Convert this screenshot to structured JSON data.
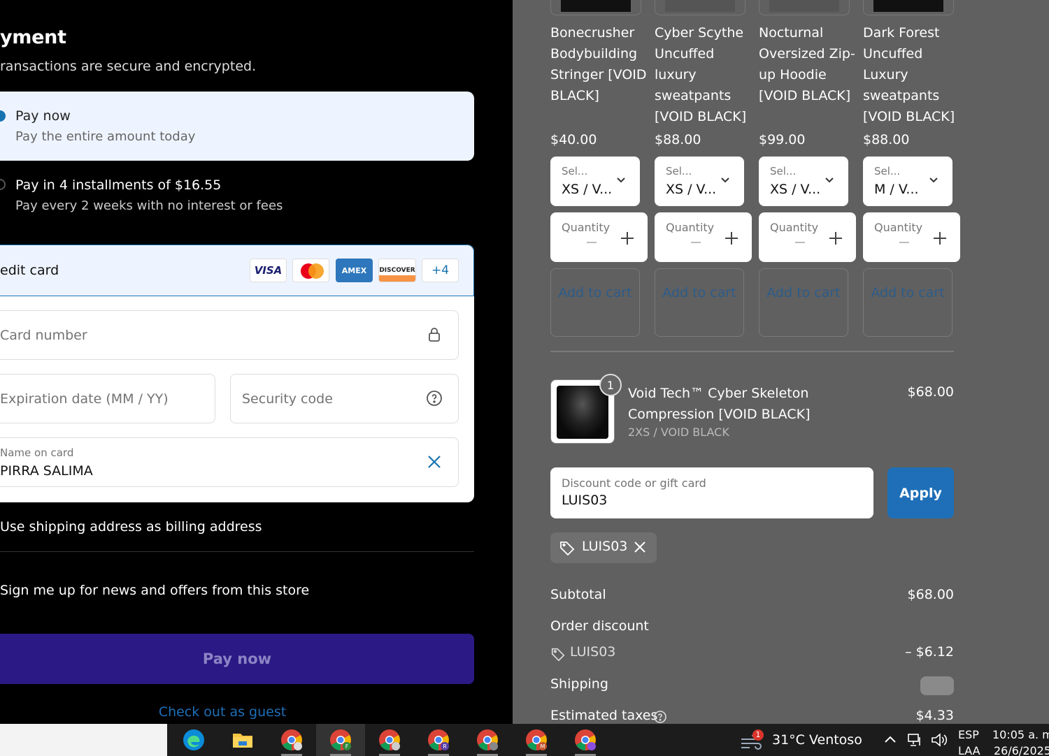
{
  "checkout": {
    "title": "yment",
    "subtitle": "ransactions are secure and encrypted.",
    "pay_options": [
      {
        "title": "Pay now",
        "desc": "Pay the entire amount today"
      },
      {
        "title": "Pay in 4 installments of $16.55",
        "desc": "Pay every 2 weeks with no interest or fees"
      }
    ],
    "credit_card": {
      "label": "edit card",
      "brands": [
        "VISA",
        "AMEX",
        "DISCOVER",
        "+4"
      ],
      "card_number_placeholder": "Card number",
      "expiration_placeholder": "Expiration date (MM / YY)",
      "security_placeholder": "Security code",
      "name_label": "Name on card",
      "name_value": "PIRRA SALIMA"
    },
    "billing_checkbox": "Use shipping address as billing address",
    "newsletter_checkbox": "Sign me up for news and offers from this store",
    "pay_button": "Pay now",
    "guest_link": "Check out as guest"
  },
  "recommendations": [
    {
      "name": "Bonecrusher Bodybuilding Stringer [VOID BLACK]",
      "price": "$40.00",
      "select_label": "Sel...",
      "select_value": "XS / V...",
      "qty_label": "Quantity",
      "add_label": "Add to cart"
    },
    {
      "name": "Cyber Scythe Uncuffed luxury sweatpants [VOID BLACK]",
      "price": "$88.00",
      "select_label": "Sel...",
      "select_value": "XS / V...",
      "qty_label": "Quantity",
      "add_label": "Add to cart"
    },
    {
      "name": "Nocturnal Oversized Zip-up Hoodie [VOID BLACK]",
      "price": "$99.00",
      "select_label": "Sel...",
      "select_value": "XS / V...",
      "qty_label": "Quantity",
      "add_label": "Add to cart"
    },
    {
      "name": "Dark Forest Uncuffed Luxury sweatpants [VOID BLACK]",
      "price": "$88.00",
      "select_label": "Sel...",
      "select_value": "M / V...",
      "qty_label": "Quantity",
      "add_label": "Add to cart"
    }
  ],
  "line_item": {
    "quantity": "1",
    "name": "Void Tech™ Cyber Skeleton Compression [VOID BLACK]",
    "variant": "2XS / VOID BLACK",
    "price": "$68.00"
  },
  "discount": {
    "label": "Discount code or gift card",
    "value": "LUIS03",
    "apply": "Apply",
    "applied_code": "LUIS03"
  },
  "summary": {
    "subtotal_label": "Subtotal",
    "subtotal_value": "$68.00",
    "order_discount_label": "Order discount",
    "discount_code": "LUIS03",
    "discount_value": "– $6.12",
    "shipping_label": "Shipping",
    "taxes_label": "Estimated taxes",
    "taxes_value": "$4.33"
  },
  "taskbar": {
    "apps": [
      "edge-icon",
      "file-explorer-icon",
      "chrome-icon",
      "chrome-icon",
      "chrome-icon",
      "chrome-icon",
      "chrome-icon",
      "chrome-icon",
      "chrome-icon"
    ],
    "profile_letters": [
      "",
      "F",
      "",
      "R",
      "",
      "M",
      ""
    ],
    "weather_badge": "1",
    "weather": "31°C  Ventoso",
    "lang_top": "ESP",
    "lang_bottom": "LAA",
    "time": "10:05 a. m.",
    "date": "26/6/2025"
  },
  "colors": {
    "accent": "#1773b0",
    "apply_button": "#1e6fb8",
    "pay_button": "#2b1a85",
    "right_panel_bg": "#606060"
  }
}
